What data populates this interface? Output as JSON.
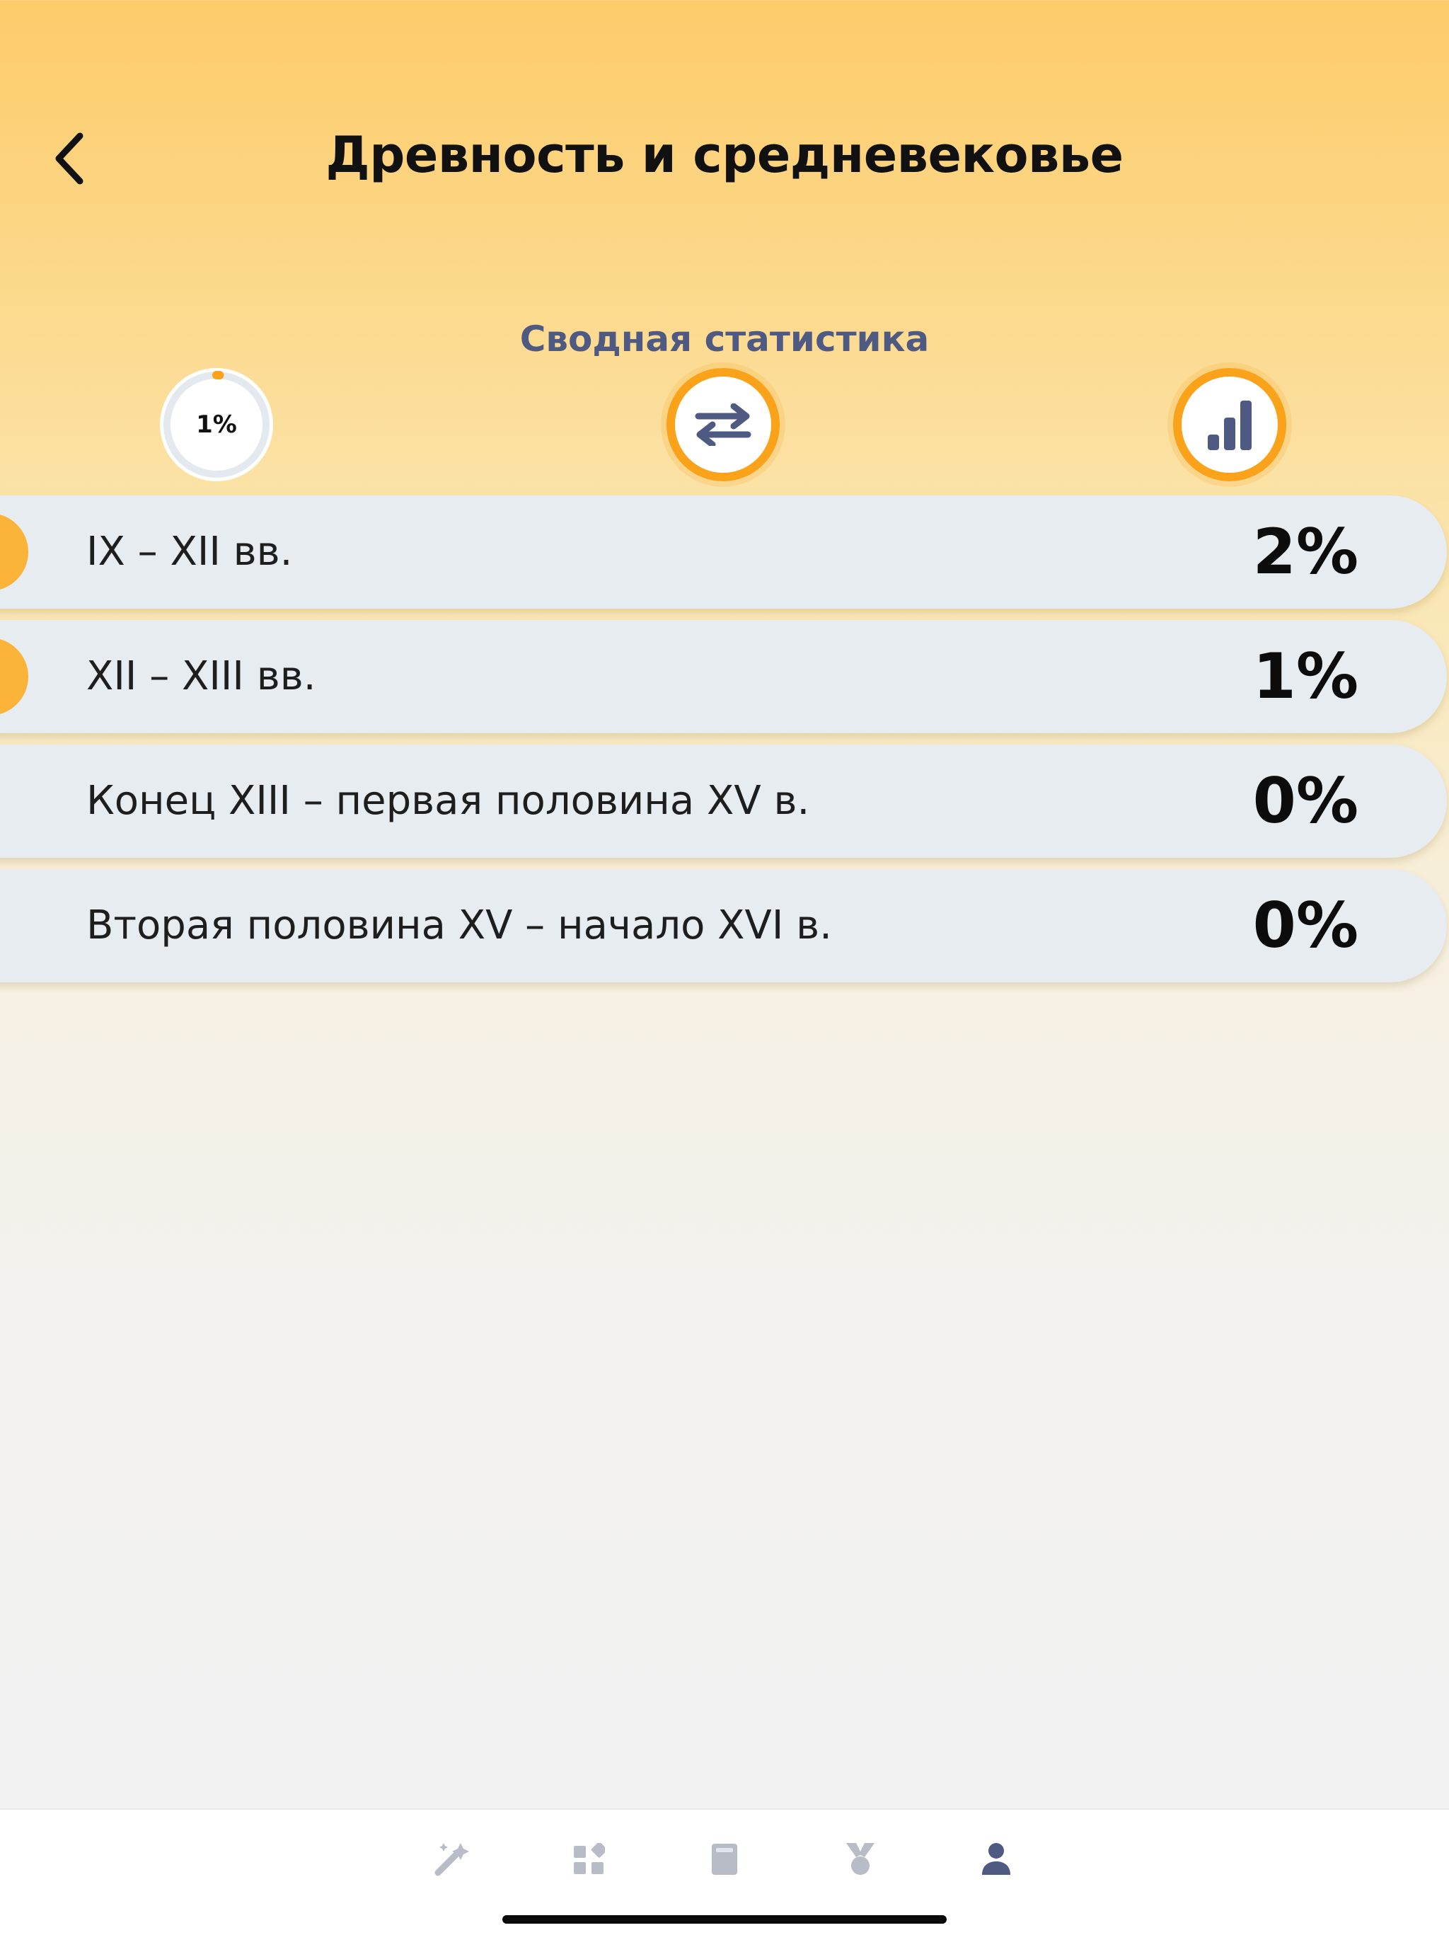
{
  "header": {
    "title": "Древность и средневековье",
    "back_icon": "chevron-left-icon"
  },
  "summary": {
    "title": "Сводная статистика",
    "overall_progress_label": "1%",
    "overall_progress": 0.01,
    "swap_icon": "swap-arrows-icon",
    "stats_icon": "bar-chart-icon"
  },
  "periods": [
    {
      "label": "IX – XII вв.",
      "value": "2%",
      "active": true
    },
    {
      "label": "XII – XIII вв.",
      "value": "1%",
      "active": true
    },
    {
      "label": "Конец XIII – первая половина XV в.",
      "value": "0%",
      "active": false
    },
    {
      "label": "Вторая половина XV – начало XVI в.",
      "value": "0%",
      "active": false
    }
  ],
  "tabbar": {
    "items": [
      {
        "icon": "magic-wand-icon",
        "active": false
      },
      {
        "icon": "blocks-icon",
        "active": false
      },
      {
        "icon": "book-icon",
        "active": false
      },
      {
        "icon": "medal-icon",
        "active": false
      },
      {
        "icon": "profile-icon",
        "active": true
      }
    ]
  },
  "colors": {
    "accent": "#F9A21A",
    "marker": "#FBB33A",
    "subtitle": "#4F5A83",
    "row_bg": "#E6ECEF",
    "tab_inactive": "#B8BCC7",
    "tab_active": "#4F5A83"
  }
}
